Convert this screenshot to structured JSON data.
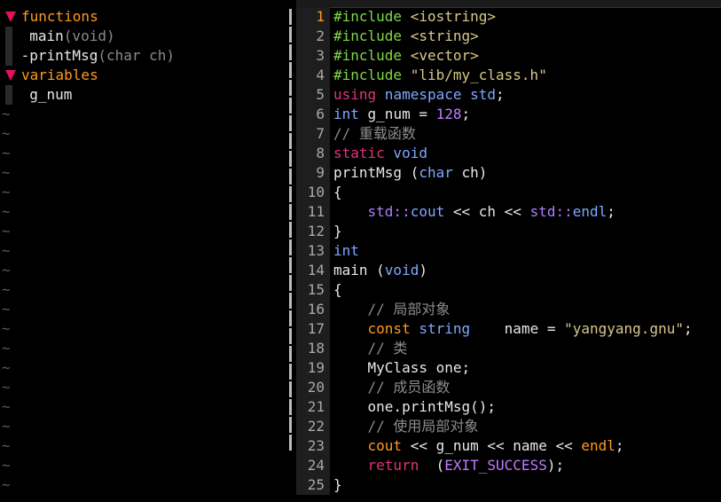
{
  "tagbar": {
    "groups": [
      {
        "title": "functions",
        "items": [
          {
            "prefix": " ",
            "name": "main",
            "sig": "(void)"
          },
          {
            "prefix": "-",
            "name": "printMsg",
            "sig": "(char ch)"
          }
        ]
      },
      {
        "title": "variables",
        "items": [
          {
            "prefix": " ",
            "name": "g_num",
            "sig": ""
          }
        ]
      }
    ],
    "filler": "~"
  },
  "editor": {
    "current_line": 1,
    "lines": [
      {
        "n": "1",
        "tokens": [
          [
            "pp",
            "#include"
          ],
          [
            "",
            ""
          ],
          [
            "str",
            " <iostring>"
          ]
        ]
      },
      {
        "n": "2",
        "tokens": [
          [
            "pp",
            "#include"
          ],
          [
            "str",
            " <string>"
          ]
        ]
      },
      {
        "n": "3",
        "tokens": [
          [
            "pp",
            "#include"
          ],
          [
            "str",
            " <vector>"
          ]
        ]
      },
      {
        "n": "4",
        "tokens": [
          [
            "pp",
            "#include"
          ],
          [
            "str",
            " \"lib/my_class.h\""
          ]
        ]
      },
      {
        "n": "5",
        "tokens": [
          [
            "kw",
            "using"
          ],
          [
            "",
            ""
          ],
          [
            "ty",
            " namespace"
          ],
          [
            "ty",
            " std"
          ],
          [
            "",
            ";"
          ]
        ]
      },
      {
        "n": "6",
        "tokens": [
          [
            "ty",
            "int"
          ],
          [
            "",
            " g_num = "
          ],
          [
            "num",
            "128"
          ],
          [
            "",
            ";"
          ]
        ]
      },
      {
        "n": "7",
        "tokens": [
          [
            "cm",
            "// 重载函数"
          ]
        ]
      },
      {
        "n": "8",
        "tokens": [
          [
            "kw",
            "static"
          ],
          [
            "ty",
            " void"
          ]
        ]
      },
      {
        "n": "9",
        "tokens": [
          [
            "",
            "printMsg ("
          ],
          [
            "ty",
            "char"
          ],
          [
            "",
            " ch)"
          ]
        ]
      },
      {
        "n": "10",
        "tokens": [
          [
            "",
            "{"
          ]
        ]
      },
      {
        "n": "11",
        "tokens": [
          [
            "",
            "    "
          ],
          [
            "ns",
            "std::"
          ],
          [
            "ty",
            "cout"
          ],
          [
            "",
            " << ch << "
          ],
          [
            "ns",
            "std::"
          ],
          [
            "ty",
            "endl"
          ],
          [
            "",
            ";"
          ]
        ]
      },
      {
        "n": "12",
        "tokens": [
          [
            "",
            "}"
          ]
        ]
      },
      {
        "n": "13",
        "tokens": [
          [
            "ty",
            "int"
          ]
        ]
      },
      {
        "n": "14",
        "tokens": [
          [
            "",
            "main ("
          ],
          [
            "ty",
            "void"
          ],
          [
            "",
            ")"
          ]
        ]
      },
      {
        "n": "15",
        "tokens": [
          [
            "",
            "{"
          ]
        ]
      },
      {
        "n": "16",
        "tokens": [
          [
            "",
            "    "
          ],
          [
            "cm",
            "// 局部对象"
          ]
        ]
      },
      {
        "n": "17",
        "tokens": [
          [
            "",
            "    "
          ],
          [
            "kw2",
            "const"
          ],
          [
            "ty",
            " string"
          ],
          [
            "",
            "    name = "
          ],
          [
            "str",
            "\"yangyang.gnu\""
          ],
          [
            "",
            ";"
          ]
        ]
      },
      {
        "n": "18",
        "tokens": [
          [
            "",
            "    "
          ],
          [
            "cm",
            "// 类"
          ]
        ]
      },
      {
        "n": "19",
        "tokens": [
          [
            "",
            "    MyClass one;"
          ]
        ]
      },
      {
        "n": "20",
        "tokens": [
          [
            "",
            "    "
          ],
          [
            "cm",
            "// 成员函数"
          ]
        ]
      },
      {
        "n": "21",
        "tokens": [
          [
            "",
            "    one.printMsg();"
          ]
        ]
      },
      {
        "n": "22",
        "tokens": [
          [
            "",
            "    "
          ],
          [
            "cm",
            "// 使用局部对象"
          ]
        ]
      },
      {
        "n": "23",
        "tokens": [
          [
            "",
            "    "
          ],
          [
            "kw2",
            "cout"
          ],
          [
            "",
            " << g_num << name << "
          ],
          [
            "kw2",
            "endl"
          ],
          [
            "",
            ";"
          ]
        ]
      },
      {
        "n": "24",
        "tokens": [
          [
            "",
            "    "
          ],
          [
            "kw",
            "return"
          ],
          [
            "",
            "  ("
          ],
          [
            "num",
            "EXIT_SUCCESS"
          ],
          [
            "",
            ");"
          ]
        ]
      },
      {
        "n": "25",
        "tokens": [
          [
            "",
            "}"
          ]
        ]
      }
    ]
  }
}
